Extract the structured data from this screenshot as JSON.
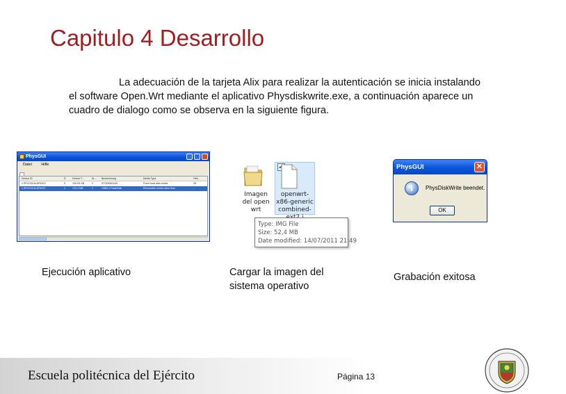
{
  "slide": {
    "title": "Capitulo 4  Desarrollo",
    "paragraph": "La adecuación de la tarjeta Alix para realizar la autenticación se inicia instalando el software Open.Wrt mediante el aplicativo Physdiskwrite.exe, a continuación aparece un cuadro de dialogo como se observa en la siguiente figura."
  },
  "physgui_window": {
    "title": "PhysGUI",
    "menu": [
      "Datei",
      "Hilfe"
    ],
    "columns": [
      "Device ID",
      "D",
      "Device T...",
      "Ar...",
      "Bezeichnung",
      "Media Type",
      "Hell..."
    ],
    "rows": [
      [
        "\\\\.\\PHYSICALDRIVE0",
        "0",
        "149.05 GB",
        "1",
        "ST3160811AS",
        "Fixed hard disk media",
        "28"
      ],
      [
        "\\\\.\\PHYSICALDRIVE1",
        "1",
        "124.4 MB",
        "1",
        "USB2.0 FlashDisk",
        "Removable media other than",
        "-"
      ]
    ]
  },
  "explorer": {
    "folder_name": "Imagen del open wrt",
    "file_name": "openwrt-x86-generic combined-ext2.i",
    "tooltip_lines": [
      "Type: IMG File",
      "Size: 52,4 MB",
      "Date modified: 14/07/2011 21:49"
    ]
  },
  "dialog": {
    "title": "PhysGUI",
    "message": "PhysDiskWrite beendet.",
    "ok_label": "OK",
    "close_glyph": "✕",
    "info_glyph": "i"
  },
  "captions": {
    "c1": "Ejecución aplicativo",
    "c2_line1": "Cargar la imagen del",
    "c2_line2": "sistema operativo",
    "c3": "Grabación exitosa"
  },
  "footer": {
    "institution": "Escuela politécnica del Ejército",
    "page": "Página 13"
  },
  "colors": {
    "title": "#a01e22",
    "xp_blue": "#0a50d8",
    "selection": "#316ac5"
  },
  "icons": [
    "app-icon",
    "checkbox-icon",
    "folder-icon",
    "file-icon",
    "info-icon",
    "close-icon",
    "crest-logo"
  ]
}
